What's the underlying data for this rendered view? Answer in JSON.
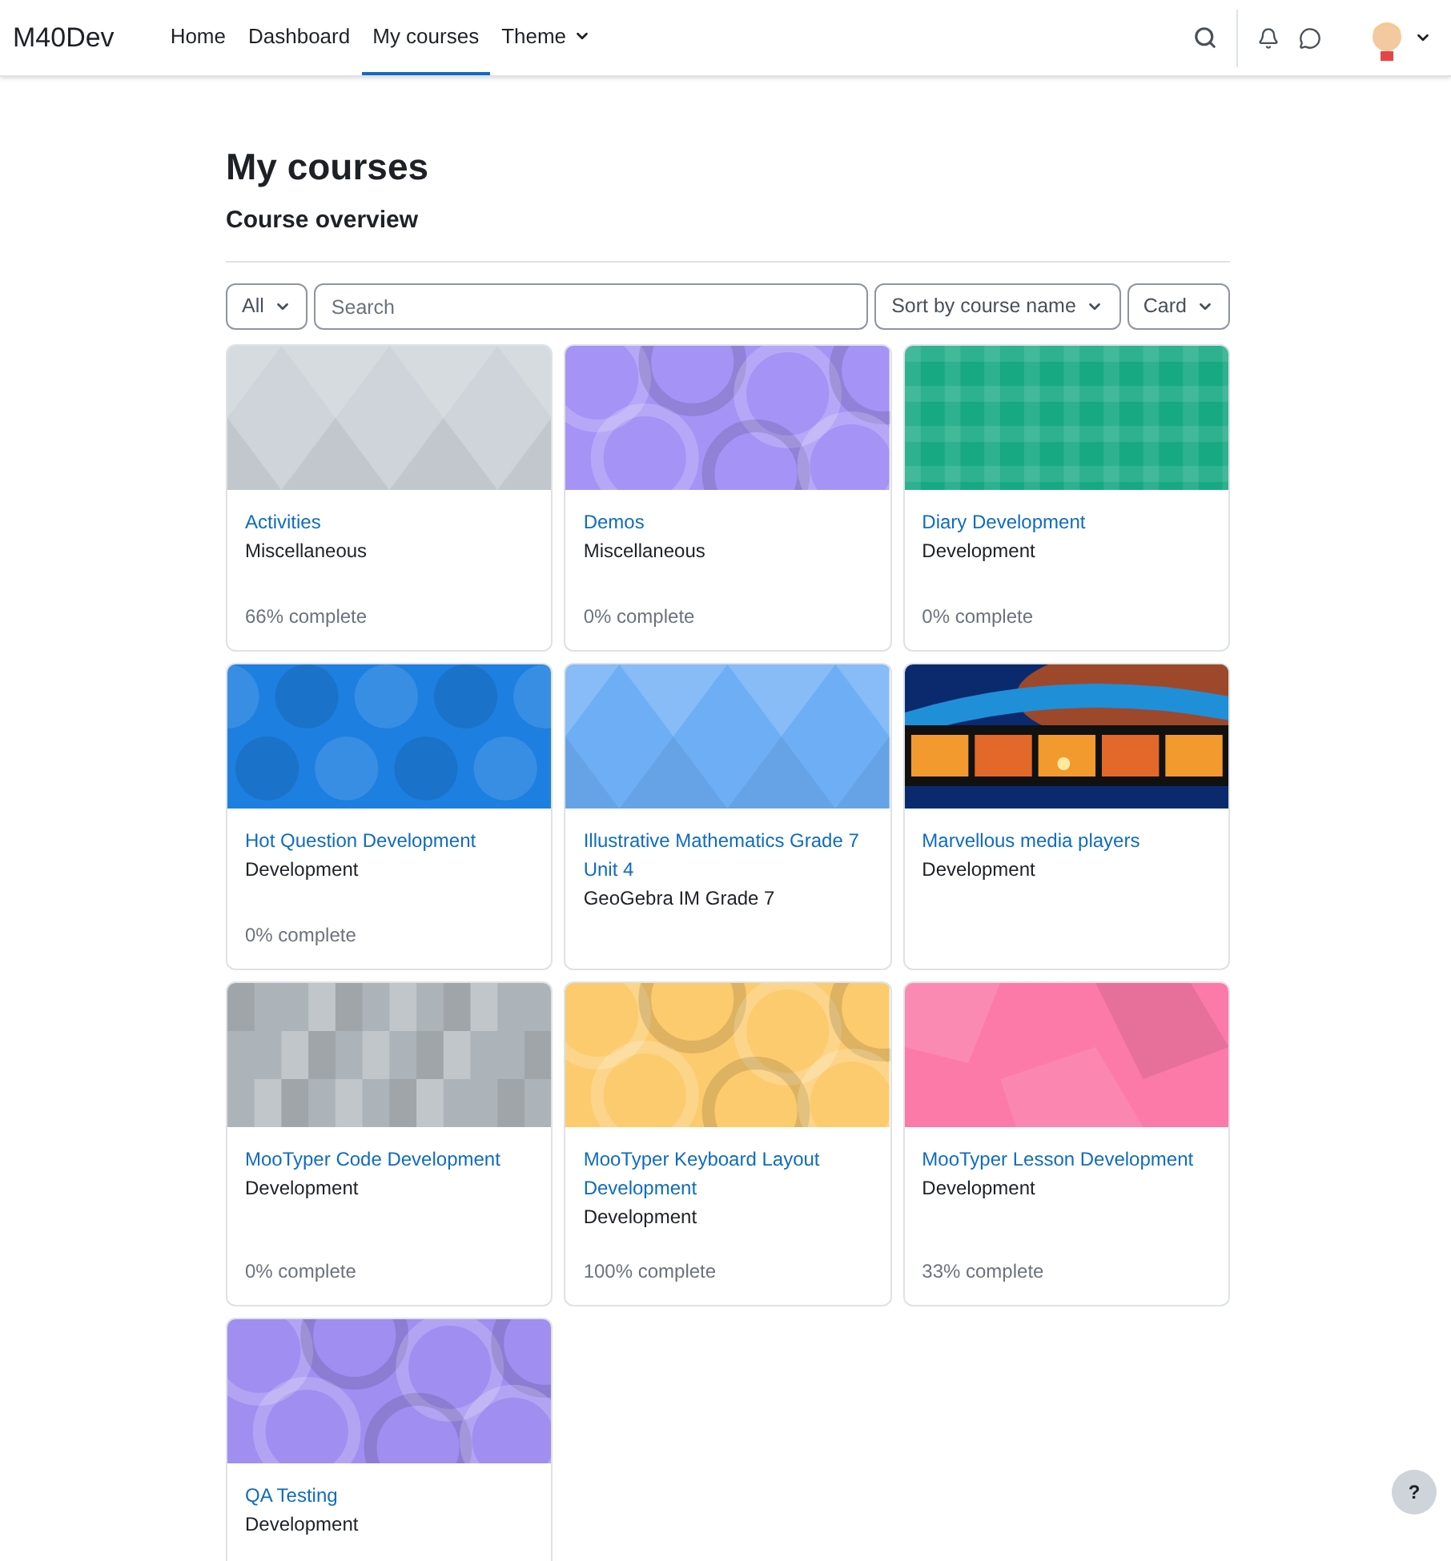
{
  "navbar": {
    "brand": "M40Dev",
    "items": [
      {
        "label": "Home",
        "selected": false,
        "dropdown": false
      },
      {
        "label": "Dashboard",
        "selected": false,
        "dropdown": false
      },
      {
        "label": "My courses",
        "selected": true,
        "dropdown": false
      },
      {
        "label": "Theme",
        "selected": false,
        "dropdown": true
      }
    ]
  },
  "page_title": "My courses",
  "section_title": "Course overview",
  "filters": {
    "grouping": "All",
    "search": {
      "placeholder": "Search"
    },
    "sort": "Sort by course name",
    "view": "Card"
  },
  "courses": [
    {
      "name": "Activities",
      "category": "Miscellaneous",
      "progress": "66% complete",
      "kind": "triangles",
      "color": "#ced4da"
    },
    {
      "name": "Demos",
      "category": "Miscellaneous",
      "progress": "0% complete",
      "kind": "circles",
      "color": "#a593f5"
    },
    {
      "name": "Diary Development",
      "category": "Development",
      "progress": "0% complete",
      "kind": "plaid",
      "color": "#16a982"
    },
    {
      "name": "Hot Question Development",
      "category": "Development",
      "progress": "0% complete",
      "kind": "octagons",
      "color": "#1d7fe0"
    },
    {
      "name": "Illustrative Mathematics Grade 7 Unit 4",
      "category": "GeoGebra IM Grade 7",
      "kind": "triangles",
      "color": "#6daef5"
    },
    {
      "name": "Marvellous media players",
      "category": "Development",
      "kind": "picture",
      "color": "#0b2a6e"
    },
    {
      "name": "MooTyper Code Development",
      "category": "Development",
      "progress": "0% complete",
      "kind": "squares",
      "color": "#b5bcc1"
    },
    {
      "name": "MooTyper Keyboard Layout Development",
      "category": "Development",
      "progress": "100% complete",
      "kind": "circles",
      "color": "#fccb6e"
    },
    {
      "name": "MooTyper Lesson Development",
      "category": "Development",
      "progress": "33% complete",
      "kind": "hexagons",
      "color": "#fb7aa8"
    },
    {
      "name": "QA Testing",
      "category": "Development",
      "kind": "circles",
      "color": "#a08ef0"
    }
  ],
  "help_button": "?"
}
